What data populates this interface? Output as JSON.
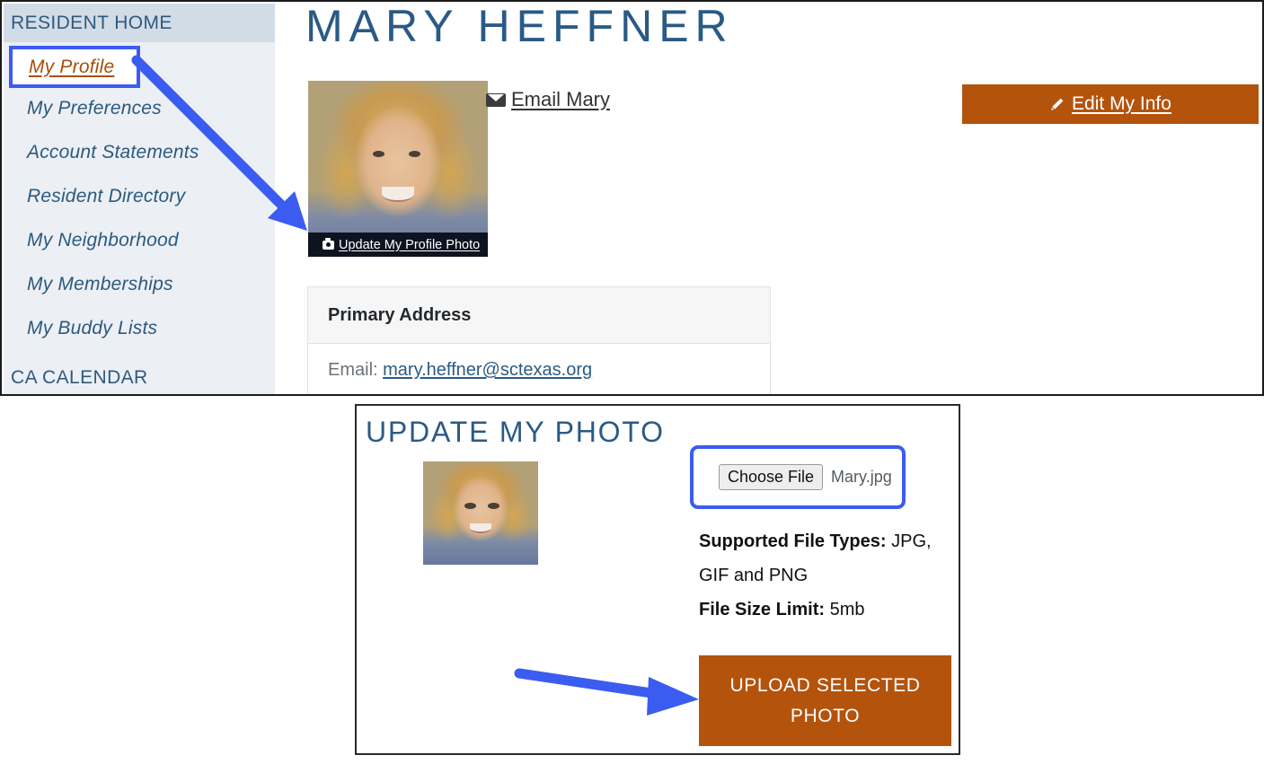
{
  "theme": {
    "accent_orange": "#b4530c",
    "link_blue": "#2a5a85",
    "annotation_blue": "#3b5cf0",
    "sidebar_header_bg": "#d2dce7",
    "sidebar_bg": "#eceff4",
    "active_link_orange": "#a84e09"
  },
  "sidebar": {
    "header_label": "RESIDENT HOME",
    "items": [
      {
        "label": "My Profile",
        "active": true
      },
      {
        "label": "My Preferences",
        "active": false
      },
      {
        "label": "Account Statements",
        "active": false
      },
      {
        "label": "Resident Directory",
        "active": false
      },
      {
        "label": "My Neighborhood",
        "active": false
      },
      {
        "label": "My Memberships",
        "active": false
      },
      {
        "label": "My Buddy Lists",
        "active": false
      }
    ],
    "footer_label": "CA CALENDAR"
  },
  "profile": {
    "page_title": "MARY  HEFFNER",
    "photo_caption": "Update My Profile Photo",
    "photo_caption_icon": "camera-icon",
    "email_link_label": "Email Mary",
    "email_link_icon": "envelope-icon",
    "edit_button_label": "Edit My Info",
    "edit_button_icon": "pencil-icon"
  },
  "address_card": {
    "title": "Primary Address",
    "email_label": "Email:",
    "email_value": "mary.heffner@sctexas.org"
  },
  "modal": {
    "title": "UPDATE MY PHOTO",
    "choose_file_button": "Choose File",
    "file_name": "Mary.jpg",
    "supported_label": "Supported File Types:",
    "supported_value": " JPG, GIF and PNG",
    "size_label": "File Size Limit:",
    "size_value": " 5mb",
    "upload_button_label": "UPLOAD SELECTED PHOTO"
  },
  "annotations": {
    "arrow_1_target": "Update My Profile Photo link",
    "arrow_2_target": "Upload Selected Photo button",
    "highlight_1_target": "My Profile sidebar item",
    "highlight_2_target": "Choose File input"
  }
}
